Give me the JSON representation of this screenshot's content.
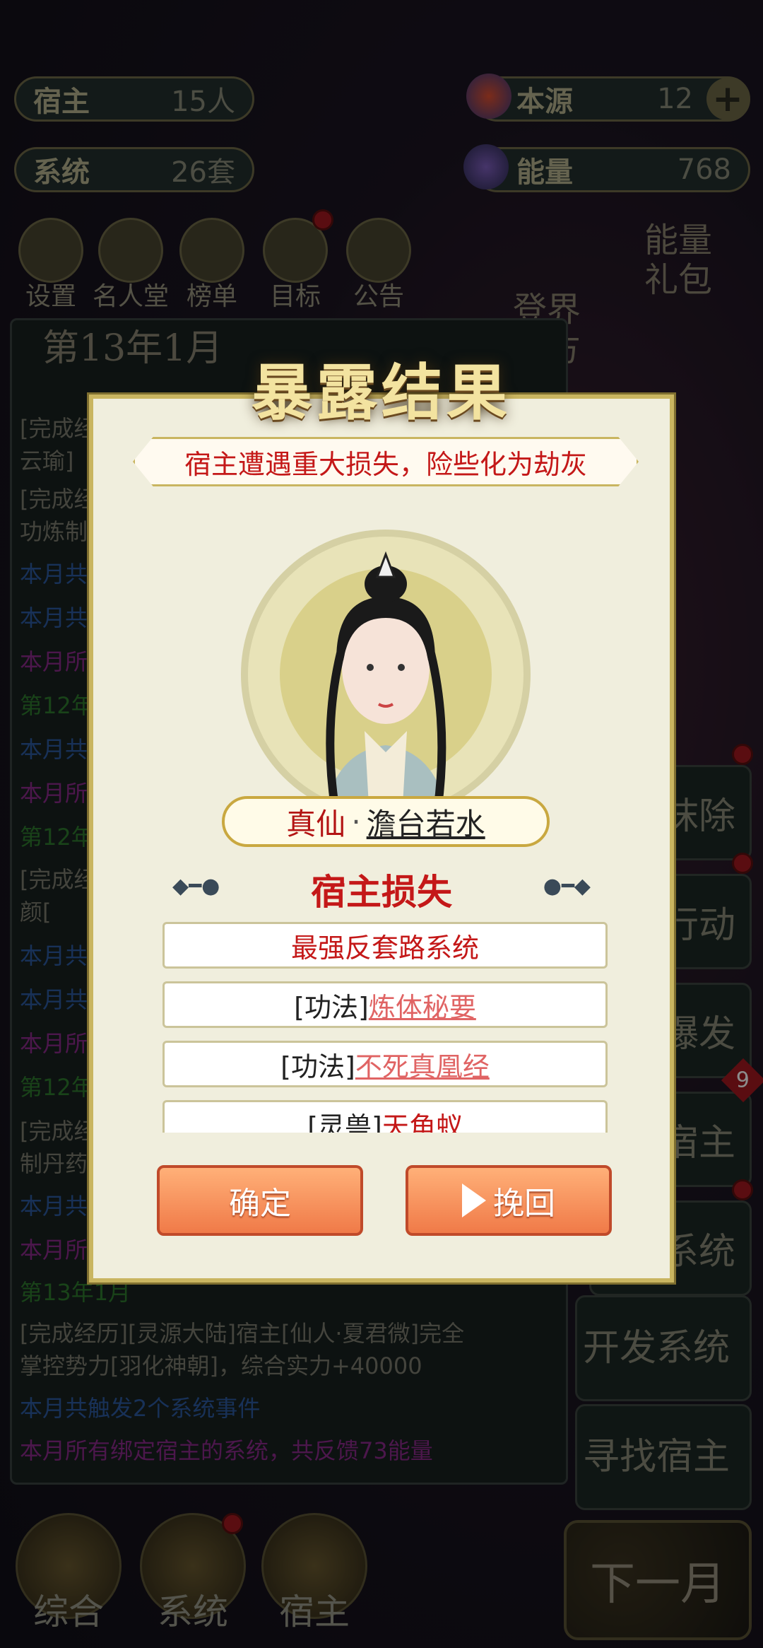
{
  "top": {
    "host": {
      "label": "宿主",
      "value": "15人"
    },
    "system": {
      "label": "系统",
      "value": "26套"
    },
    "source": {
      "label": "本源",
      "value": "12"
    },
    "energy": {
      "label": "能量",
      "value": "768"
    }
  },
  "menu": [
    {
      "label": "设置"
    },
    {
      "label": "名人堂"
    },
    {
      "label": "榜单"
    },
    {
      "label": "目标"
    },
    {
      "label": "公告"
    }
  ],
  "energy_pack": "能量礼包",
  "login_tour": "登界游方",
  "date": "第13年1月",
  "side_buttons": [
    "抹除",
    "行动",
    "爆发",
    "宿主",
    "系统",
    "开发系统",
    "寻找宿主"
  ],
  "host_badge": "9",
  "log": [
    {
      "text": "[完成经",
      "color": "#7d7d70"
    },
    {
      "text": "云瑜]",
      "color": "#7d7d70"
    },
    {
      "text": "[完成经",
      "color": "#7d7d70"
    },
    {
      "text": "功炼制",
      "color": "#7d7d70"
    },
    {
      "text": "本月共",
      "color": "#2c5aa0"
    },
    {
      "text": "本月共",
      "color": "#2c5aa0"
    },
    {
      "text": "本月所",
      "color": "#8a2a8a"
    },
    {
      "text": "第12年",
      "color": "#2f7a2f"
    },
    {
      "text": "本月共",
      "color": "#2c5aa0"
    },
    {
      "text": "本月所",
      "color": "#8a2a8a"
    },
    {
      "text": "第12年",
      "color": "#2f7a2f"
    },
    {
      "text": "[完成经",
      "color": "#7d7d70"
    },
    {
      "text": "颜[",
      "color": "#7d7d70"
    },
    {
      "text": "本月共",
      "color": "#2c5aa0"
    },
    {
      "text": "本月共",
      "color": "#2c5aa0"
    },
    {
      "text": "本月所",
      "color": "#8a2a8a"
    },
    {
      "text": "第12年",
      "color": "#2f7a2f"
    },
    {
      "text": "[完成经",
      "color": "#7d7d70"
    },
    {
      "text": "制丹药",
      "color": "#7d7d70"
    },
    {
      "text": "本月共",
      "color": "#2c5aa0"
    },
    {
      "text": "本月所",
      "color": "#8a2a8a"
    },
    {
      "text": "第13年1月",
      "color": "#2f7a2f"
    },
    {
      "text": "[完成经历][灵源大陆]宿主[仙人·夏君微]完全",
      "color": "#7d7d70"
    },
    {
      "text": "掌控势力[羽化神朝]，综合实力+40000",
      "color": "#7d7d70"
    },
    {
      "text": "本月共触发2个系统事件",
      "color": "#2c5aa0"
    },
    {
      "text": "本月所有绑定宿主的系统，共反馈73能量",
      "color": "#8a2a8a"
    }
  ],
  "bottom_nav": [
    {
      "label": "综合"
    },
    {
      "label": "系统"
    },
    {
      "label": "宿主"
    }
  ],
  "next_month": "下一月",
  "modal": {
    "title": "暴露结果",
    "banner": "宿主遭遇重大损失，险些化为劫灰",
    "rank": "真仙",
    "sep": "·",
    "name": "澹台若水",
    "section": "宿主损失",
    "losses": [
      {
        "prefix": "",
        "name": "最强反套路系统"
      },
      {
        "prefix": "[功法]",
        "name": "炼体秘要"
      },
      {
        "prefix": "[功法]",
        "name": "不死真凰经"
      },
      {
        "prefix": "[灵兽]",
        "name": "天角蚁"
      }
    ],
    "confirm": "确定",
    "recover": "挽回"
  }
}
